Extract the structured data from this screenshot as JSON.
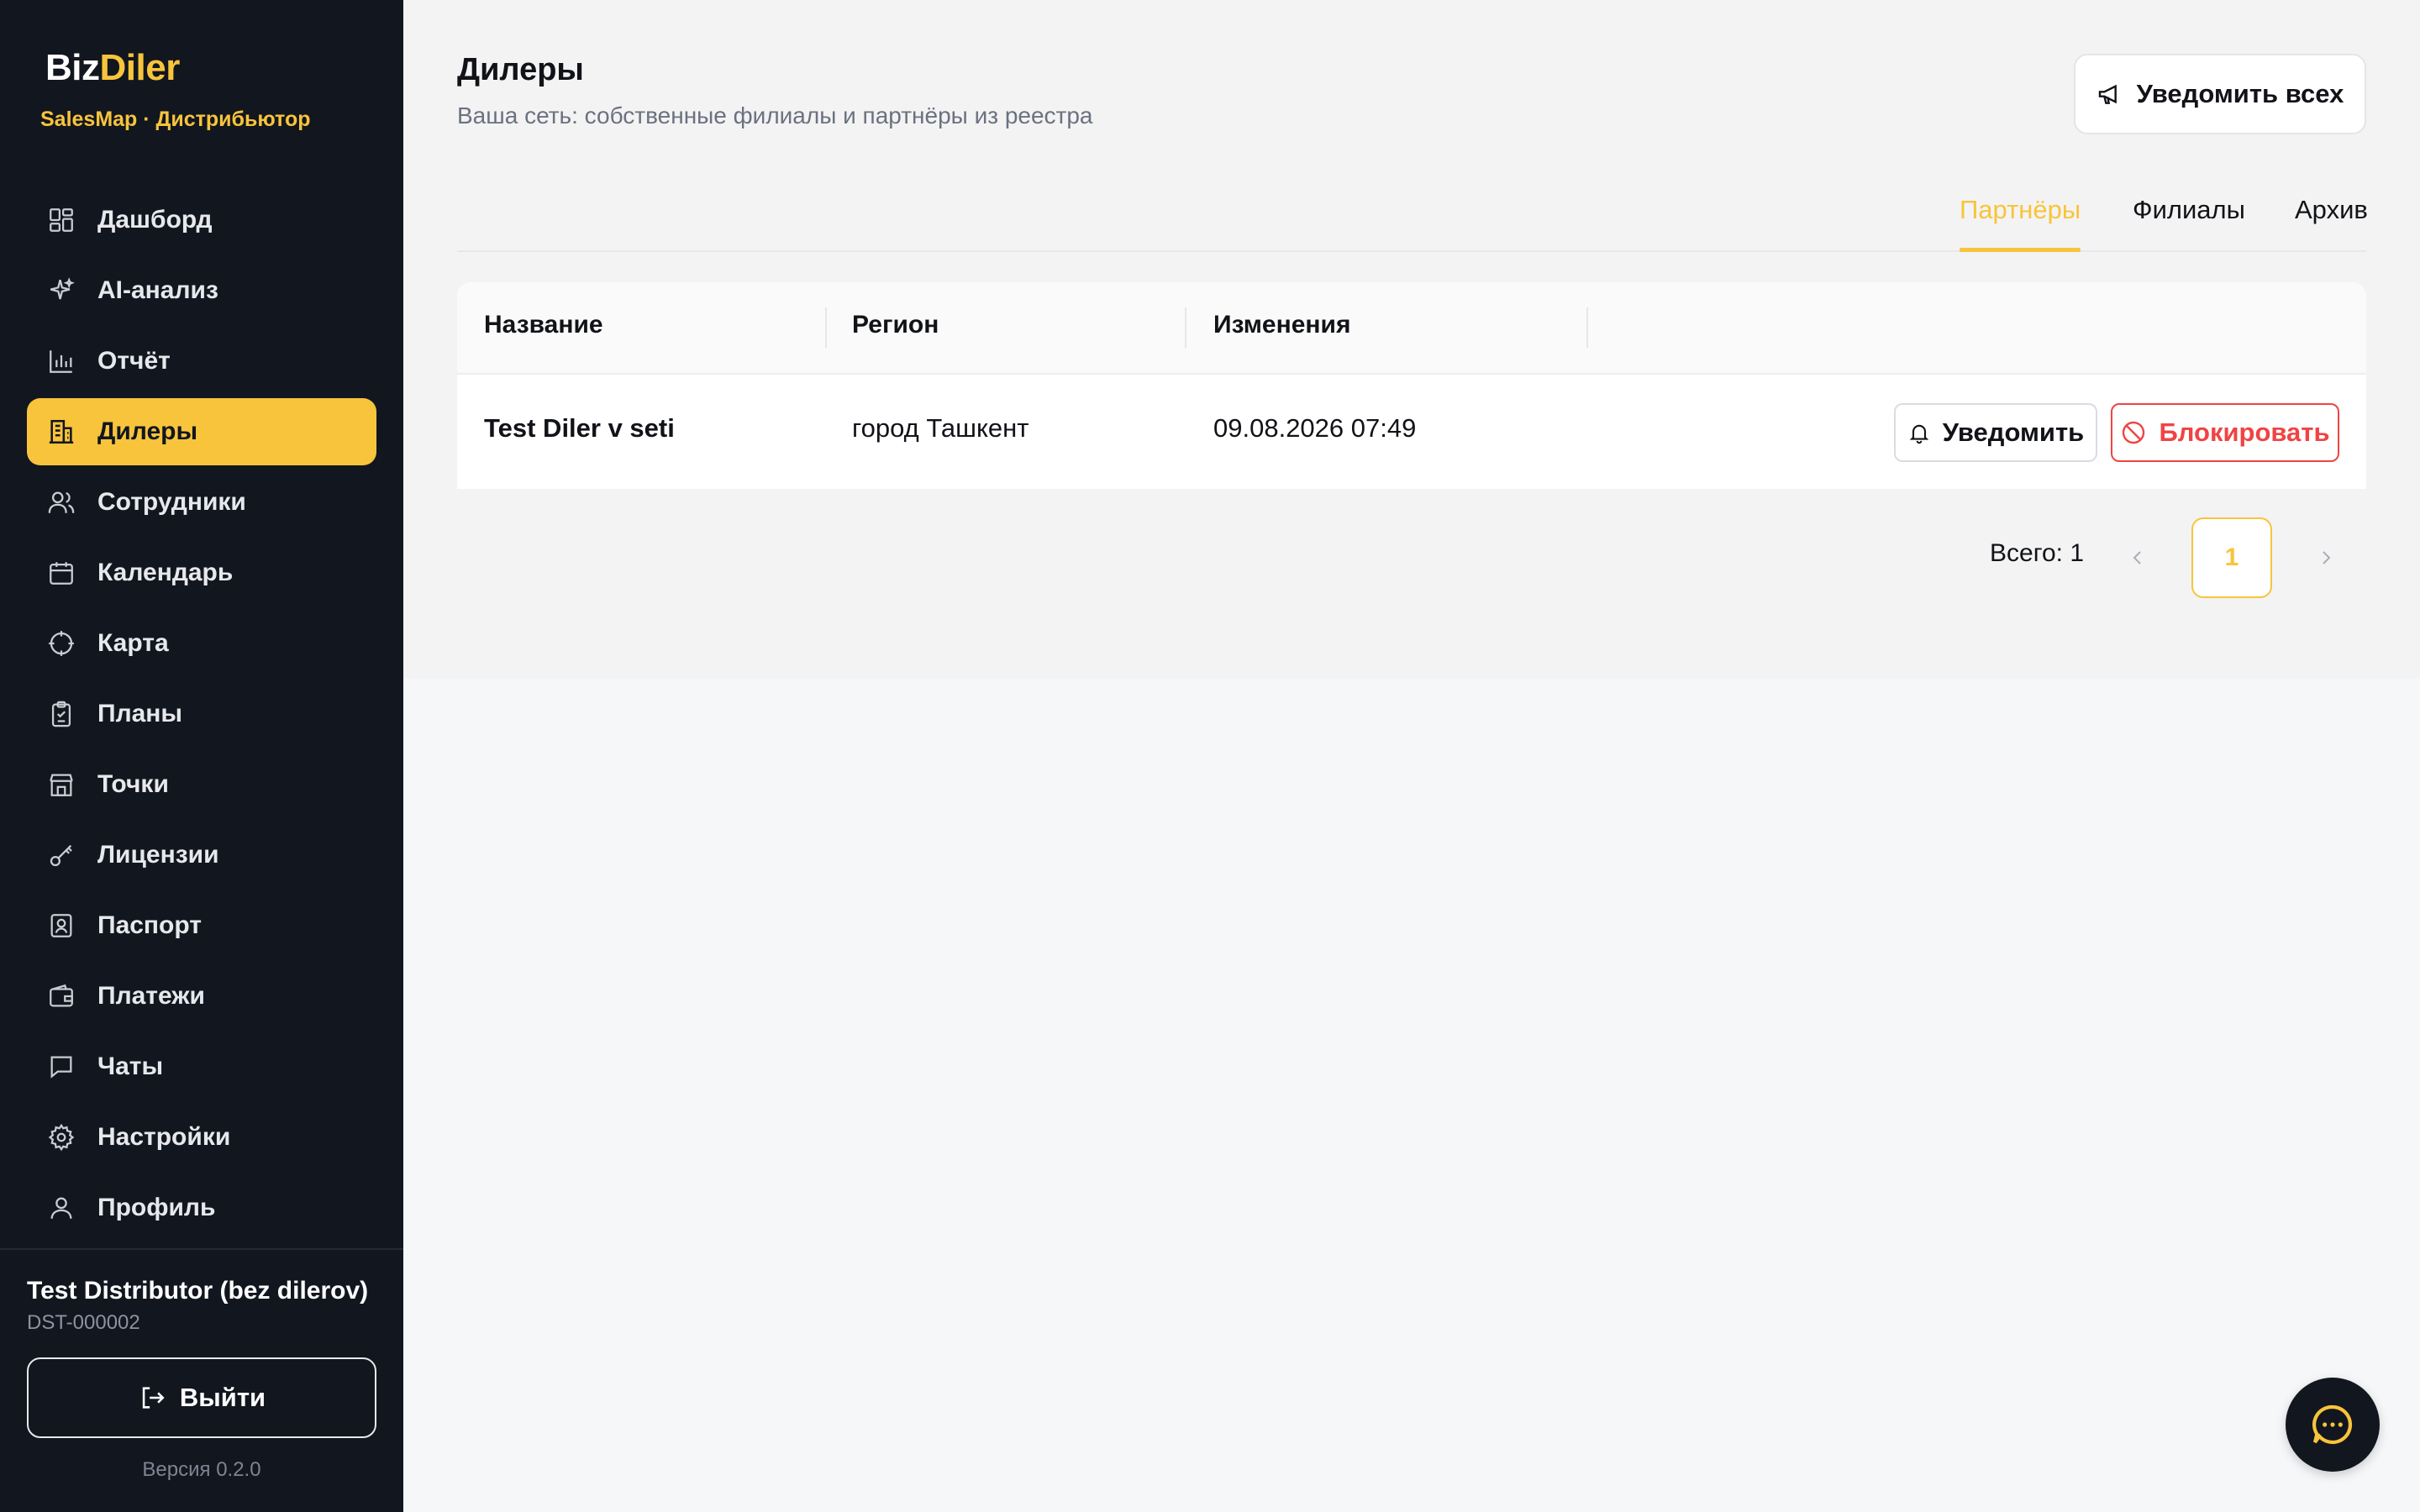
{
  "brand": {
    "part1": "Biz",
    "part2": "Diler",
    "subtitle": "SalesMap · Дистрибьютор"
  },
  "sidebar": {
    "items": [
      {
        "label": "Дашборд",
        "icon": "dashboard-icon"
      },
      {
        "label": "AI-анализ",
        "icon": "sparkle-icon"
      },
      {
        "label": "Отчёт",
        "icon": "bar-chart-icon"
      },
      {
        "label": "Дилеры",
        "icon": "building-icon",
        "active": true
      },
      {
        "label": "Сотрудники",
        "icon": "users-icon"
      },
      {
        "label": "Календарь",
        "icon": "calendar-icon"
      },
      {
        "label": "Карта",
        "icon": "map-target-icon"
      },
      {
        "label": "Планы",
        "icon": "clipboard-icon"
      },
      {
        "label": "Точки",
        "icon": "store-icon"
      },
      {
        "label": "Лицензии",
        "icon": "key-icon"
      },
      {
        "label": "Паспорт",
        "icon": "id-card-icon"
      },
      {
        "label": "Платежи",
        "icon": "wallet-icon"
      },
      {
        "label": "Чаты",
        "icon": "chat-icon"
      },
      {
        "label": "Настройки",
        "icon": "gear-icon"
      },
      {
        "label": "Профиль",
        "icon": "user-icon"
      }
    ],
    "org_name": "Test Distributor (bez dilerov)",
    "org_code": "DST-000002",
    "logout_label": "Выйти",
    "version": "Версия 0.2.0"
  },
  "header": {
    "title": "Дилеры",
    "subtitle": "Ваша сеть: собственные филиалы и партнёры из реестра",
    "notify_all_label": "Уведомить всех"
  },
  "tabs": [
    {
      "label": "Партнёры",
      "active": true
    },
    {
      "label": "Филиалы"
    },
    {
      "label": "Архив"
    }
  ],
  "table": {
    "columns": [
      "Название",
      "Регион",
      "Изменения"
    ],
    "rows": [
      {
        "name": "Test Diler v seti",
        "region": "город Ташкент",
        "changed": "09.08.2026 07:49",
        "notify_label": "Уведомить",
        "block_label": "Блокировать"
      }
    ]
  },
  "pagination": {
    "total_label": "Всего: 1",
    "current_page": "1"
  },
  "colors": {
    "accent": "#f7c43b",
    "sidebar_bg": "#12161f",
    "danger": "#ef4444"
  }
}
